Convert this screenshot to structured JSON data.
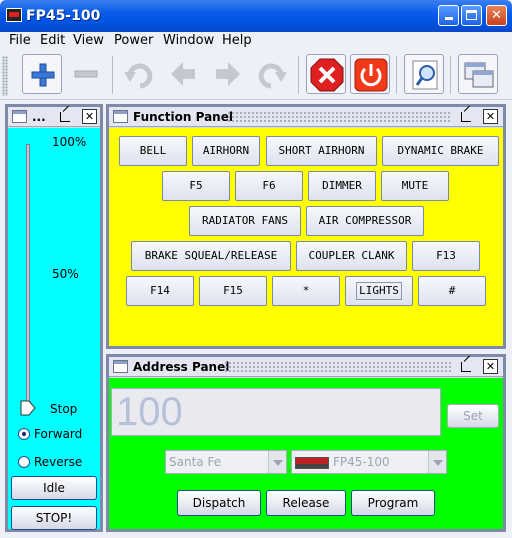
{
  "window": {
    "title": "FP45-100",
    "icon": "train-app-icon",
    "controls": {
      "minimize": "minimize-icon",
      "maximize": "maximize-icon",
      "close": "close-icon"
    }
  },
  "menu": [
    "File",
    "Edit",
    "View",
    "Power",
    "Window",
    "Help"
  ],
  "toolbar": {
    "buttons": [
      {
        "icon": "add-icon",
        "enabled": true
      },
      {
        "icon": "remove-icon",
        "enabled": false
      },
      {
        "icon": "undo-icon",
        "enabled": false
      },
      {
        "icon": "back-icon",
        "enabled": false
      },
      {
        "icon": "forward-icon",
        "enabled": false
      },
      {
        "icon": "redo-icon",
        "enabled": false
      },
      {
        "icon": "stop-icon",
        "enabled": true
      },
      {
        "icon": "power-icon",
        "enabled": true
      },
      {
        "icon": "edit-icon",
        "enabled": true
      },
      {
        "icon": "windows-icon",
        "enabled": true
      }
    ]
  },
  "throttle": {
    "title": "...",
    "speed_labels": {
      "max": "100%",
      "mid": "50%",
      "stop": "Stop"
    },
    "speed_level": 0,
    "direction": {
      "forward": "Forward",
      "reverse": "Reverse",
      "selected": "forward"
    },
    "idle_label": "Idle",
    "stop_label": "STOP!"
  },
  "function_panel": {
    "title": "Function Panel",
    "rows": [
      [
        "BELL",
        "AIRHORN",
        "SHORT AIRHORN",
        "DYNAMIC BRAKE"
      ],
      [
        "F5",
        "F6",
        "DIMMER",
        "MUTE"
      ],
      [
        "RADIATOR FANS",
        "AIR COMPRESSOR"
      ],
      [
        "BRAKE SQUEAL/RELEASE",
        "COUPLER CLANK",
        "F13"
      ],
      [
        "F14",
        "F15",
        "*",
        "LIGHTS",
        "#"
      ]
    ],
    "focused": "LIGHTS",
    "background": "#ffff00"
  },
  "address_panel": {
    "title": "Address Panel",
    "address_value": "100",
    "set_label": "Set",
    "roster_group": "Santa Fe",
    "roster_entry": "FP45-100",
    "dispatch_label": "Dispatch",
    "release_label": "Release",
    "program_label": "Program",
    "background": "#00ff00"
  }
}
